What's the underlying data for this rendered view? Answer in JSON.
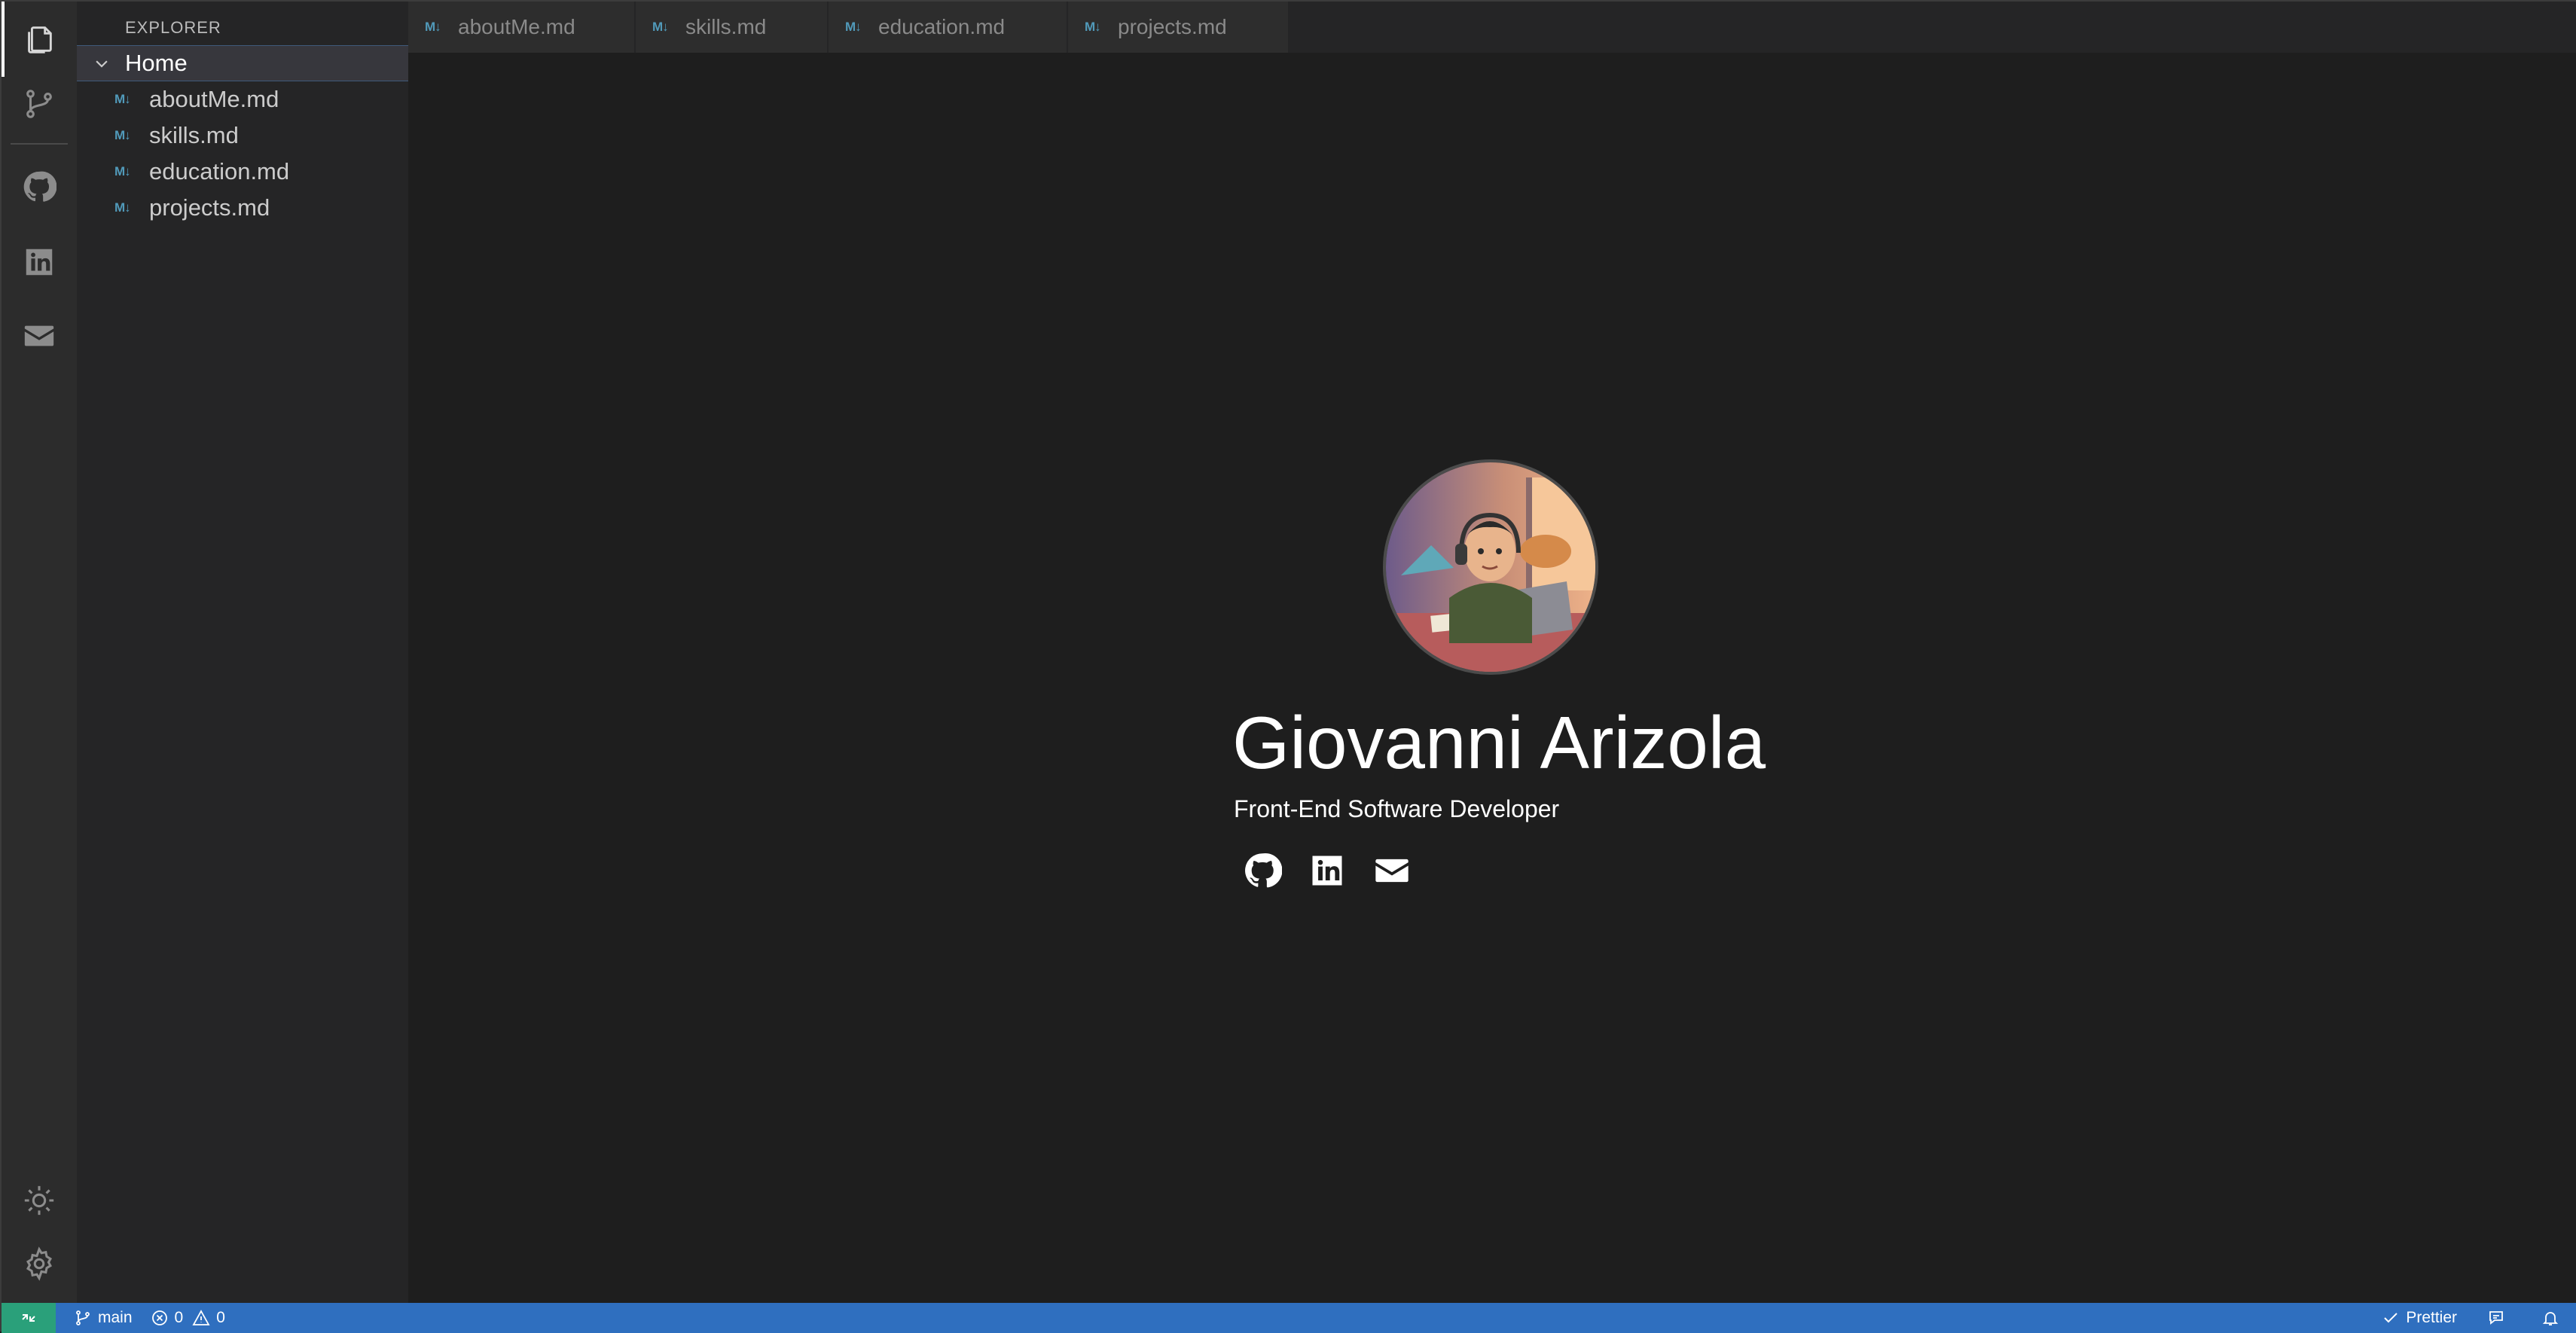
{
  "activity_bar": {
    "items": [
      {
        "icon": "files-icon",
        "active": true
      },
      {
        "icon": "source-control-icon"
      },
      {
        "icon": "github-icon"
      },
      {
        "icon": "linkedin-icon"
      },
      {
        "icon": "mail-icon"
      }
    ],
    "bottom_items": [
      {
        "icon": "sun-icon"
      },
      {
        "icon": "gear-icon"
      }
    ]
  },
  "sidebar": {
    "title": "EXPLORER",
    "root": "Home",
    "md_badge": "M↓",
    "files": [
      "aboutMe.md",
      "skills.md",
      "education.md",
      "projects.md"
    ]
  },
  "tabs": [
    "aboutMe.md",
    "skills.md",
    "education.md",
    "projects.md"
  ],
  "profile": {
    "name": "Giovanni Arizola",
    "role": "Front-End Software Developer",
    "links": [
      "github-icon",
      "linkedin-icon",
      "mail-icon"
    ]
  },
  "statusbar": {
    "branch": "main",
    "errors": "0",
    "warnings": "0",
    "formatter": "Prettier"
  },
  "colors": {
    "editor_bg": "#1e1e1e",
    "sidebar_bg": "#252526",
    "activity_bg": "#2c2c2c",
    "statusbar_bg": "#2f6fbf",
    "remote_bg": "#2aa07a",
    "md_badge": "#519aba"
  }
}
